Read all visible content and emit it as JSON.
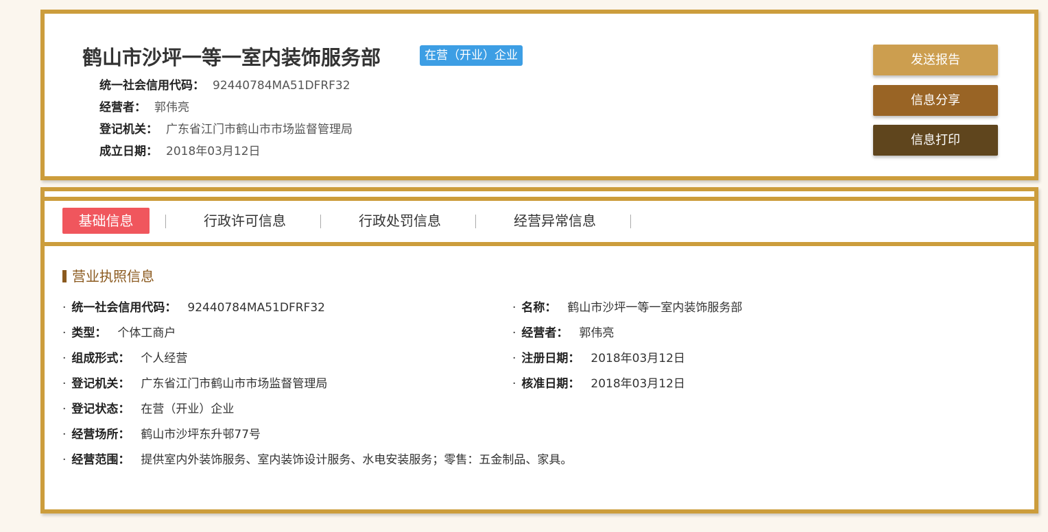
{
  "header": {
    "company_name": "鹤山市沙坪一等一室内装饰服务部",
    "status_badge": "在营（开业）企业",
    "rows": [
      {
        "label": "统一社会信用代码：",
        "value": "92440784MA51DFRF32"
      },
      {
        "label": "经营者：",
        "value": "郭伟亮"
      },
      {
        "label": "登记机关：",
        "value": "广东省江门市鹤山市市场监督管理局"
      },
      {
        "label": "成立日期：",
        "value": "2018年03月12日"
      }
    ],
    "buttons": {
      "report": "发送报告",
      "share": "信息分享",
      "print": "信息打印"
    }
  },
  "tabs": [
    {
      "label": "基础信息",
      "active": true
    },
    {
      "label": "行政许可信息",
      "active": false
    },
    {
      "label": "行政处罚信息",
      "active": false
    },
    {
      "label": "经营异常信息",
      "active": false
    }
  ],
  "section": {
    "title": "营业执照信息",
    "bullet": "·",
    "left_rows": [
      {
        "label": "统一社会信用代码：",
        "value": "92440784MA51DFRF32"
      },
      {
        "label": "类型：",
        "value": "个体工商户"
      },
      {
        "label": "组成形式：",
        "value": "个人经营"
      },
      {
        "label": "登记机关：",
        "value": "广东省江门市鹤山市市场监督管理局"
      },
      {
        "label": "登记状态：",
        "value": "在营（开业）企业"
      },
      {
        "label": "经营场所：",
        "value": "鹤山市沙坪东升邨77号"
      },
      {
        "label": "经营范围：",
        "value": "提供室内外装饰服务、室内装饰设计服务、水电安装服务；零售：五金制品、家具。"
      }
    ],
    "right_rows": [
      {
        "label": "名称：",
        "value": "鹤山市沙坪一等一室内装饰服务部"
      },
      {
        "label": "经营者：",
        "value": "郭伟亮"
      },
      {
        "label": "注册日期：",
        "value": "2018年03月12日"
      },
      {
        "label": "核准日期：",
        "value": "2018年03月12日"
      }
    ]
  }
}
